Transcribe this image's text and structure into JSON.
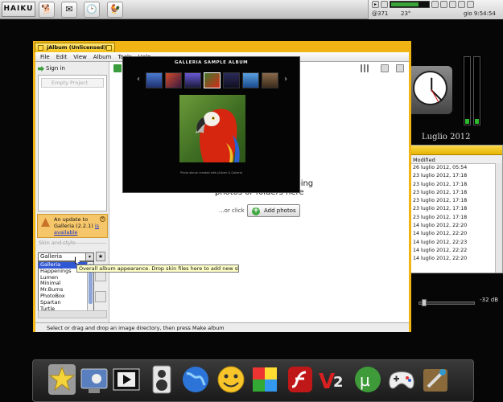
{
  "topbar": {
    "logo_main": "HAIKU",
    "clock_text": "gio 9:54:54",
    "cpu_text": "@371",
    "temp_text": "23°"
  },
  "window": {
    "title": "jAlbum (Unlicensed)",
    "menu": [
      "File",
      "Edit",
      "View",
      "Album",
      "Tools",
      "Help"
    ],
    "sign_in": "Sign in",
    "empty_project": "Empty Project",
    "update": {
      "line1": "An update to",
      "line2": "Galleria (2.2.1)",
      "link1": "is",
      "link2": "available"
    },
    "skin_section": "Skin and style",
    "selected_skin": "Galleria",
    "skins": [
      "Galleria",
      "Happenings",
      "Lumen",
      "Minimal",
      "Mr.Burns",
      "PhotoBox",
      "Spartan",
      "Turtle"
    ],
    "tooltip": "Overall album appearance. Drop skin files here to add new skins",
    "drop_line1": "pping",
    "drop_line2": "photos or folders here",
    "or_click": "...or click",
    "add_photos": "Add photos",
    "status": "Select or drag and drop an image directory, then press Make album",
    "toolbar_partial": "A"
  },
  "preview": {
    "title": "GALLERIA SAMPLE ALBUM",
    "nav_prev": "‹",
    "nav_next": "›",
    "caption": "Photo album created with jAlbum & Galleria"
  },
  "desktop": {
    "calendar": "Luglio 2012",
    "tracker_column": "Modified",
    "tracker_rows": [
      "26 luglio 2012, 05:54",
      "23 luglio 2012, 17:18",
      "23 luglio 2012, 17:18",
      "23 luglio 2012, 17:18",
      "23 luglio 2012, 17:18",
      "23 luglio 2012, 17:18",
      "23 luglio 2012, 17:18",
      "14 luglio 2012, 22:20",
      "14 luglio 2012, 22:20",
      "14 luglio 2012, 22:23",
      "14 luglio 2012, 22:22",
      "14 luglio 2012, 22:20"
    ],
    "volume_db": "-32 dB"
  },
  "icons": {
    "deskbar": [
      "dog-icon",
      "mail-icon",
      "clock-icon",
      "rooster-icon"
    ],
    "dock": [
      "star-icon",
      "monitor-icon",
      "film-icon",
      "speaker-icon",
      "globe-icon",
      "smiley-icon",
      "puzzle-icon",
      "flash-icon",
      "v2-icon",
      "utorrent-icon",
      "gamepad-icon",
      "tools-icon"
    ]
  },
  "colors": {
    "window_frame": "#f0b514",
    "selection": "#3158d4",
    "tooltip_bg": "#ffffc8"
  }
}
